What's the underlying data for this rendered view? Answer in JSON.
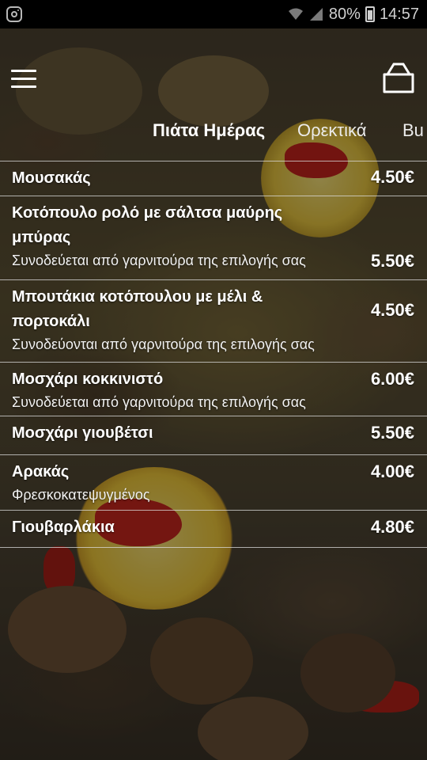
{
  "status_bar": {
    "battery": "80%",
    "time": "14:57",
    "app_icon": "instagram-icon",
    "icons": [
      "wifi-icon",
      "signal-icon",
      "battery-icon"
    ]
  },
  "header": {
    "menu_icon": "hamburger-menu-icon",
    "cart_icon": "shopping-bag-icon"
  },
  "tabs": [
    {
      "label": "Πιάτα Ημέρας",
      "active": true
    },
    {
      "label": "Ορεκτικά",
      "active": false
    },
    {
      "label": "Bu",
      "active": false
    }
  ],
  "menu_items": [
    {
      "name": "Μουσακάς",
      "desc": "",
      "price": "4.50€"
    },
    {
      "name": "Κοτόπουλο ρολό με σάλτσα μαύρης μπύρας",
      "desc": "Συνοδεύεται από γαρνιτούρα της επιλογής σας",
      "price": "5.50€"
    },
    {
      "name": "Μπουτάκια κοτόπουλου με μέλι & πορτοκάλι",
      "desc": "Συνοδεύονται από γαρνιτούρα της επιλογής σας",
      "price": "4.50€"
    },
    {
      "name": "Μοσχάρι κοκκινιστό",
      "desc": "Συνοδεύεται από γαρνιτούρα της επιλογής σας",
      "price": "6.00€"
    },
    {
      "name": "Μοσχάρι γιουβέτσι",
      "desc": "",
      "price": "5.50€"
    },
    {
      "name": "Αρακάς",
      "desc": "Φρεσκοκατεψυγμένος",
      "price": "4.00€"
    },
    {
      "name": "Γιουβαρλάκια",
      "desc": "",
      "price": "4.80€"
    }
  ],
  "colors": {
    "text": "#ffffff",
    "divider": "#dcdcdc",
    "status_bar_bg": "#000000"
  }
}
